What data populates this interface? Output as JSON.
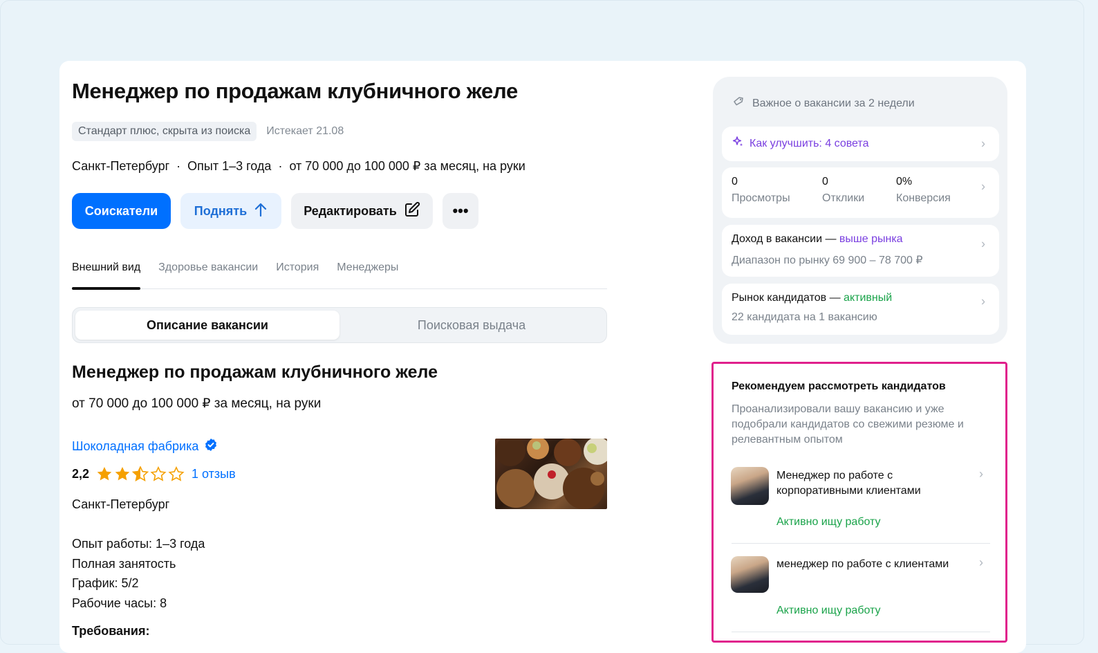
{
  "vacancy": {
    "title": "Менеджер по продажам клубничного желе",
    "badge": "Стандарт плюс, скрыта из поиска",
    "expires": "Истекает 21.08",
    "city": "Санкт-Петербург",
    "experience": "Опыт 1–3 года",
    "salary": "от 70 000 до 100 000 ₽ за месяц, на руки"
  },
  "actions": {
    "applicants": "Соискатели",
    "raise": "Поднять",
    "edit": "Редактировать",
    "more": "•••"
  },
  "tabs": [
    {
      "label": "Внешний вид",
      "active": true
    },
    {
      "label": "Здоровье вакансии"
    },
    {
      "label": "История"
    },
    {
      "label": "Менеджеры"
    }
  ],
  "segment": {
    "description": "Описание вакансии",
    "search": "Поисковая выдача"
  },
  "preview": {
    "title": "Менеджер по продажам клубничного желе",
    "salary": "от 70 000 до 100 000 ₽ за месяц, на руки",
    "company": "Шоколадная фабрика",
    "rating": "2,2",
    "rating_value": 2.5,
    "reviews": "1 отзыв",
    "city": "Санкт-Петербург",
    "details": [
      "Опыт работы: 1–3 года",
      "Полная занятость",
      "График: 5/2",
      "Рабочие часы: 8"
    ],
    "requirements": "Требования:"
  },
  "side": {
    "header": "Важное о вакансии за 2 недели",
    "improve": "Как улучшить: 4 совета",
    "stats": [
      {
        "value": "0",
        "label": "Просмотры"
      },
      {
        "value": "0",
        "label": "Отклики"
      },
      {
        "value": "0%",
        "label": "Конверсия"
      }
    ],
    "income_title": "Доход в вакансии —",
    "income_status": "выше рынка",
    "income_range": "Диапазон по рынку 69 900 – 78 700 ₽",
    "market_title": "Рынок кандидатов —",
    "market_status": "активный",
    "market_sub": "22 кандидата на 1 вакансию"
  },
  "recommend": {
    "title": "Рекомендуем рассмотреть кандидатов",
    "desc": "Проанализировали вашу вакансию и уже подобрали кандидатов со свежими резюме и релевантным опытом",
    "candidates": [
      {
        "name": "Менеджер по работе с корпоративными клиентами",
        "status": "Активно ищу работу"
      },
      {
        "name": "менеджер по работе с клиентами",
        "status": "Активно ищу работу"
      }
    ]
  },
  "colors": {
    "primary": "#0070ff",
    "purple": "#7a3fe0",
    "green": "#1aa34a",
    "highlight": "#e0208c",
    "star": "#f5a000"
  }
}
